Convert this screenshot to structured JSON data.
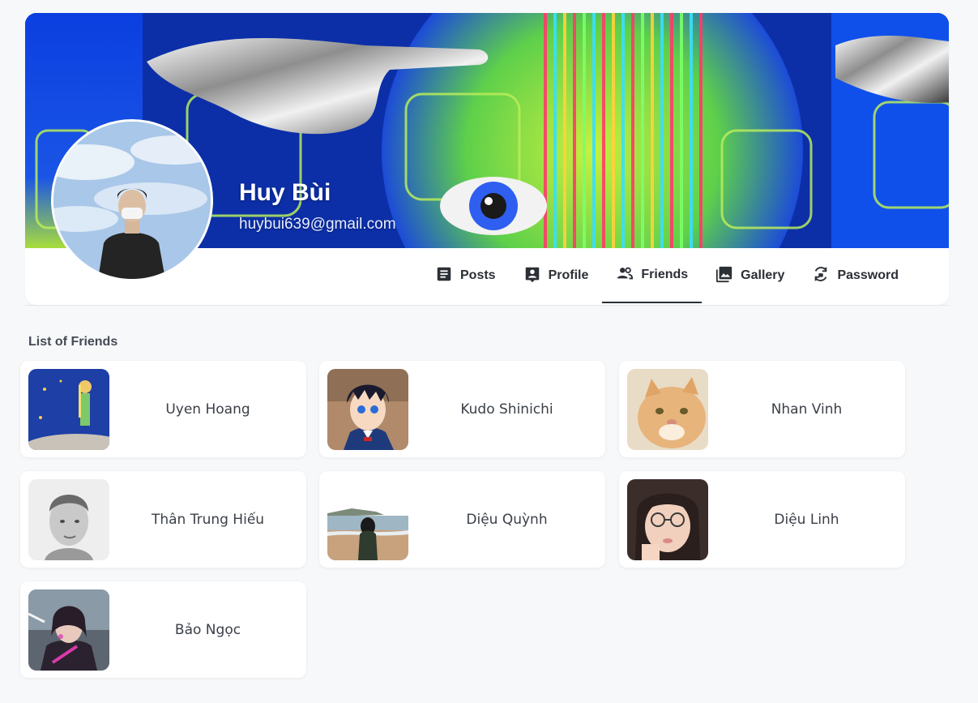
{
  "profile": {
    "name": "Huy Bùi",
    "email": "huybui639@gmail.com"
  },
  "tabs": [
    {
      "label": "Posts",
      "icon": "article-icon"
    },
    {
      "label": "Profile",
      "icon": "profile-icon"
    },
    {
      "label": "Friends",
      "icon": "people-icon",
      "active": true
    },
    {
      "label": "Gallery",
      "icon": "image-icon"
    },
    {
      "label": "Password",
      "icon": "password-reset-icon"
    }
  ],
  "friends_section": {
    "title": "List of Friends"
  },
  "friends": [
    {
      "name": "Uyen Hoang"
    },
    {
      "name": "Kudo Shinichi"
    },
    {
      "name": "Nhan Vinh"
    },
    {
      "name": "Thân Trung Hiếu"
    },
    {
      "name": "Diệu Quỳnh"
    },
    {
      "name": "Diệu Linh"
    },
    {
      "name": "Bảo Ngọc"
    }
  ],
  "colors": {
    "cover_blue": "#0b3fe0",
    "cover_green": "#b7e63a",
    "active_tab_underline": "#2b2f36"
  }
}
